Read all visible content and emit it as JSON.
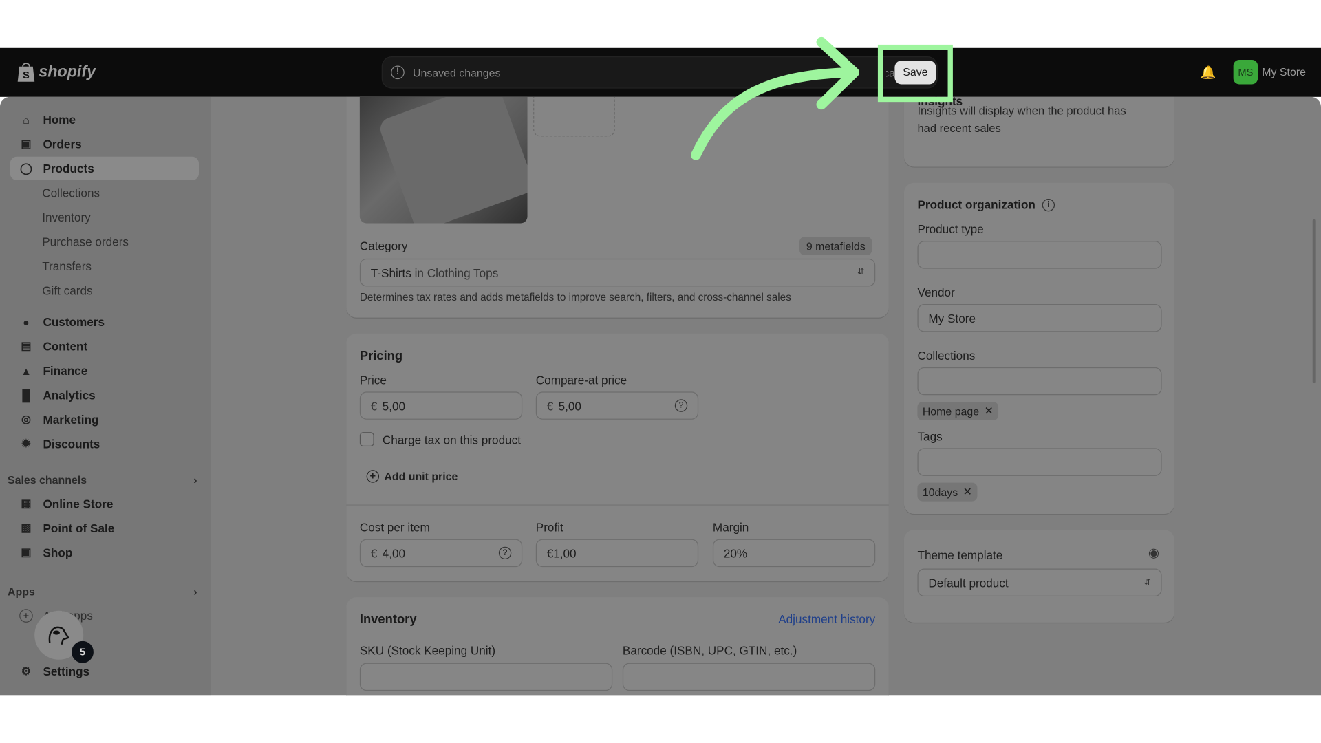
{
  "header": {
    "logo": "shopify",
    "unsaved": "Unsaved changes",
    "discard": "Discard",
    "save": "Save",
    "store_initials": "MS",
    "store_name": "My Store"
  },
  "sidebar": {
    "items": [
      {
        "label": "Home",
        "icon": "home-icon"
      },
      {
        "label": "Orders",
        "icon": "inbox-icon"
      },
      {
        "label": "Products",
        "icon": "tag-icon"
      }
    ],
    "product_sub": [
      "Collections",
      "Inventory",
      "Purchase orders",
      "Transfers",
      "Gift cards"
    ],
    "items2": [
      {
        "label": "Customers",
        "icon": "person-icon"
      },
      {
        "label": "Content",
        "icon": "content-icon"
      },
      {
        "label": "Finance",
        "icon": "bank-icon"
      },
      {
        "label": "Analytics",
        "icon": "bar-chart-icon"
      },
      {
        "label": "Marketing",
        "icon": "target-icon"
      },
      {
        "label": "Discounts",
        "icon": "discount-icon"
      }
    ],
    "sales_channels": "Sales channels",
    "channels": [
      {
        "label": "Online Store",
        "icon": "store-icon"
      },
      {
        "label": "Point of Sale",
        "icon": "pos-icon"
      },
      {
        "label": "Shop",
        "icon": "shop-icon"
      }
    ],
    "apps": "Apps",
    "add_apps": "Add apps",
    "settings": "Settings",
    "widget_badge": "5"
  },
  "category": {
    "label": "Category",
    "metafields": "9 metafields",
    "value_bold": "T-Shirts",
    "value_rest": " in Clothing Tops",
    "help": "Determines tax rates and adds metafields to improve search, filters, and cross-channel sales"
  },
  "pricing": {
    "title": "Pricing",
    "price_label": "Price",
    "price": "5,00",
    "compare_label": "Compare-at price",
    "compare": "5,00",
    "currency": "€",
    "charge_tax": "Charge tax on this product",
    "charge_tax_checked": false,
    "add_unit": "Add unit price",
    "cost_label": "Cost per item",
    "cost": "4,00",
    "profit_label": "Profit",
    "profit": "€1,00",
    "margin_label": "Margin",
    "margin": "20%"
  },
  "inventory": {
    "title": "Inventory",
    "adjust": "Adjustment history",
    "sku": "SKU (Stock Keeping Unit)",
    "barcode": "Barcode (ISBN, UPC, GTIN, etc.)"
  },
  "insights": {
    "title": "Insights",
    "text1": "Insights will display when the product has",
    "text2": "had recent sales"
  },
  "org": {
    "title": "Product organization",
    "type": "Product type",
    "vendor": "Vendor",
    "vendor_value": "My Store",
    "collections": "Collections",
    "collection_chip": "Home page",
    "tags": "Tags",
    "tag_chip": "10days"
  },
  "theme": {
    "title": "Theme template",
    "value": "Default product"
  },
  "colors": {
    "annotation": "#9ef59e",
    "header": "#0c0c0c",
    "avatar": "#3aa83a"
  }
}
